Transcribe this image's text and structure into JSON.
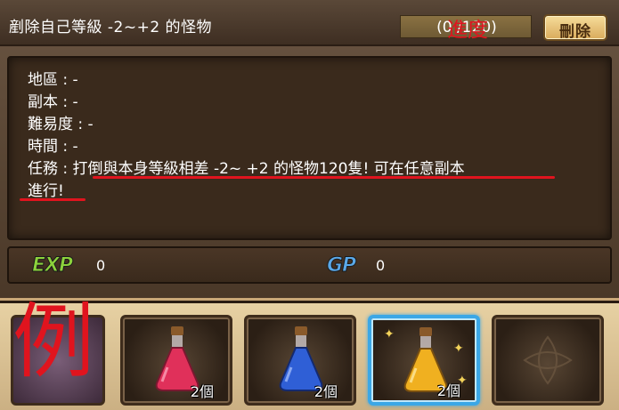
{
  "quest": {
    "title": "剷除自己等級 -2~+2 的怪物",
    "progress_text": "(0 /120)",
    "progress_overlay": "進度",
    "delete_label": "刪除"
  },
  "info": {
    "region": "地區 : -",
    "dungeon": "副本 : -",
    "difficulty": "難易度 : -",
    "time": "時間 : -",
    "mission_line1": "任務 : 打倒與本身等級相差 -2~ +2 的怪物120隻! 可在任意副本",
    "mission_line2": "進行!"
  },
  "rewards": {
    "exp_label": "EXP",
    "exp_value": "0",
    "gp_label": "GP",
    "gp_value": "0"
  },
  "items": [
    {
      "potion": "red-potion-icon",
      "color": "#e0305a",
      "qty": "2個"
    },
    {
      "potion": "blue-potion-icon",
      "color": "#2f5fd6",
      "qty": "2個"
    },
    {
      "potion": "yellow-potion-icon",
      "color": "#f0b020",
      "qty": "2個"
    }
  ],
  "sample_label": "例",
  "colors": {
    "annotation_red": "#e0141e",
    "exp_green": "#8cd23c",
    "gp_blue": "#5aa8e8",
    "selected_border": "#3ba7e6"
  }
}
